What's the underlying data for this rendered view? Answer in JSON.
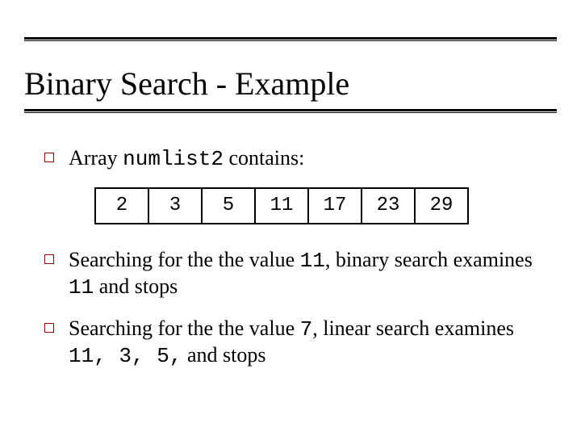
{
  "title": "Binary Search - Example",
  "bullets": [
    {
      "pre": "Array ",
      "code": "numlist2",
      "post": " contains:"
    },
    {
      "segments": [
        "Searching for the the value ",
        "11",
        ", binary search examines ",
        "11",
        " and stops"
      ]
    },
    {
      "segments": [
        "Searching for the the value ",
        "7",
        ", linear search examines ",
        "11, 3, 5,",
        " and stops"
      ]
    }
  ],
  "array": [
    "2",
    "3",
    "5",
    "11",
    "17",
    "23",
    "29"
  ],
  "chart_data": {
    "type": "table",
    "title": "Array numlist2 contains",
    "values": [
      2,
      3,
      5,
      11,
      17,
      23,
      29
    ]
  },
  "colors": {
    "bullet_outline": "#8b0000",
    "rule": "#000000",
    "text": "#000000",
    "background": "#ffffff"
  }
}
